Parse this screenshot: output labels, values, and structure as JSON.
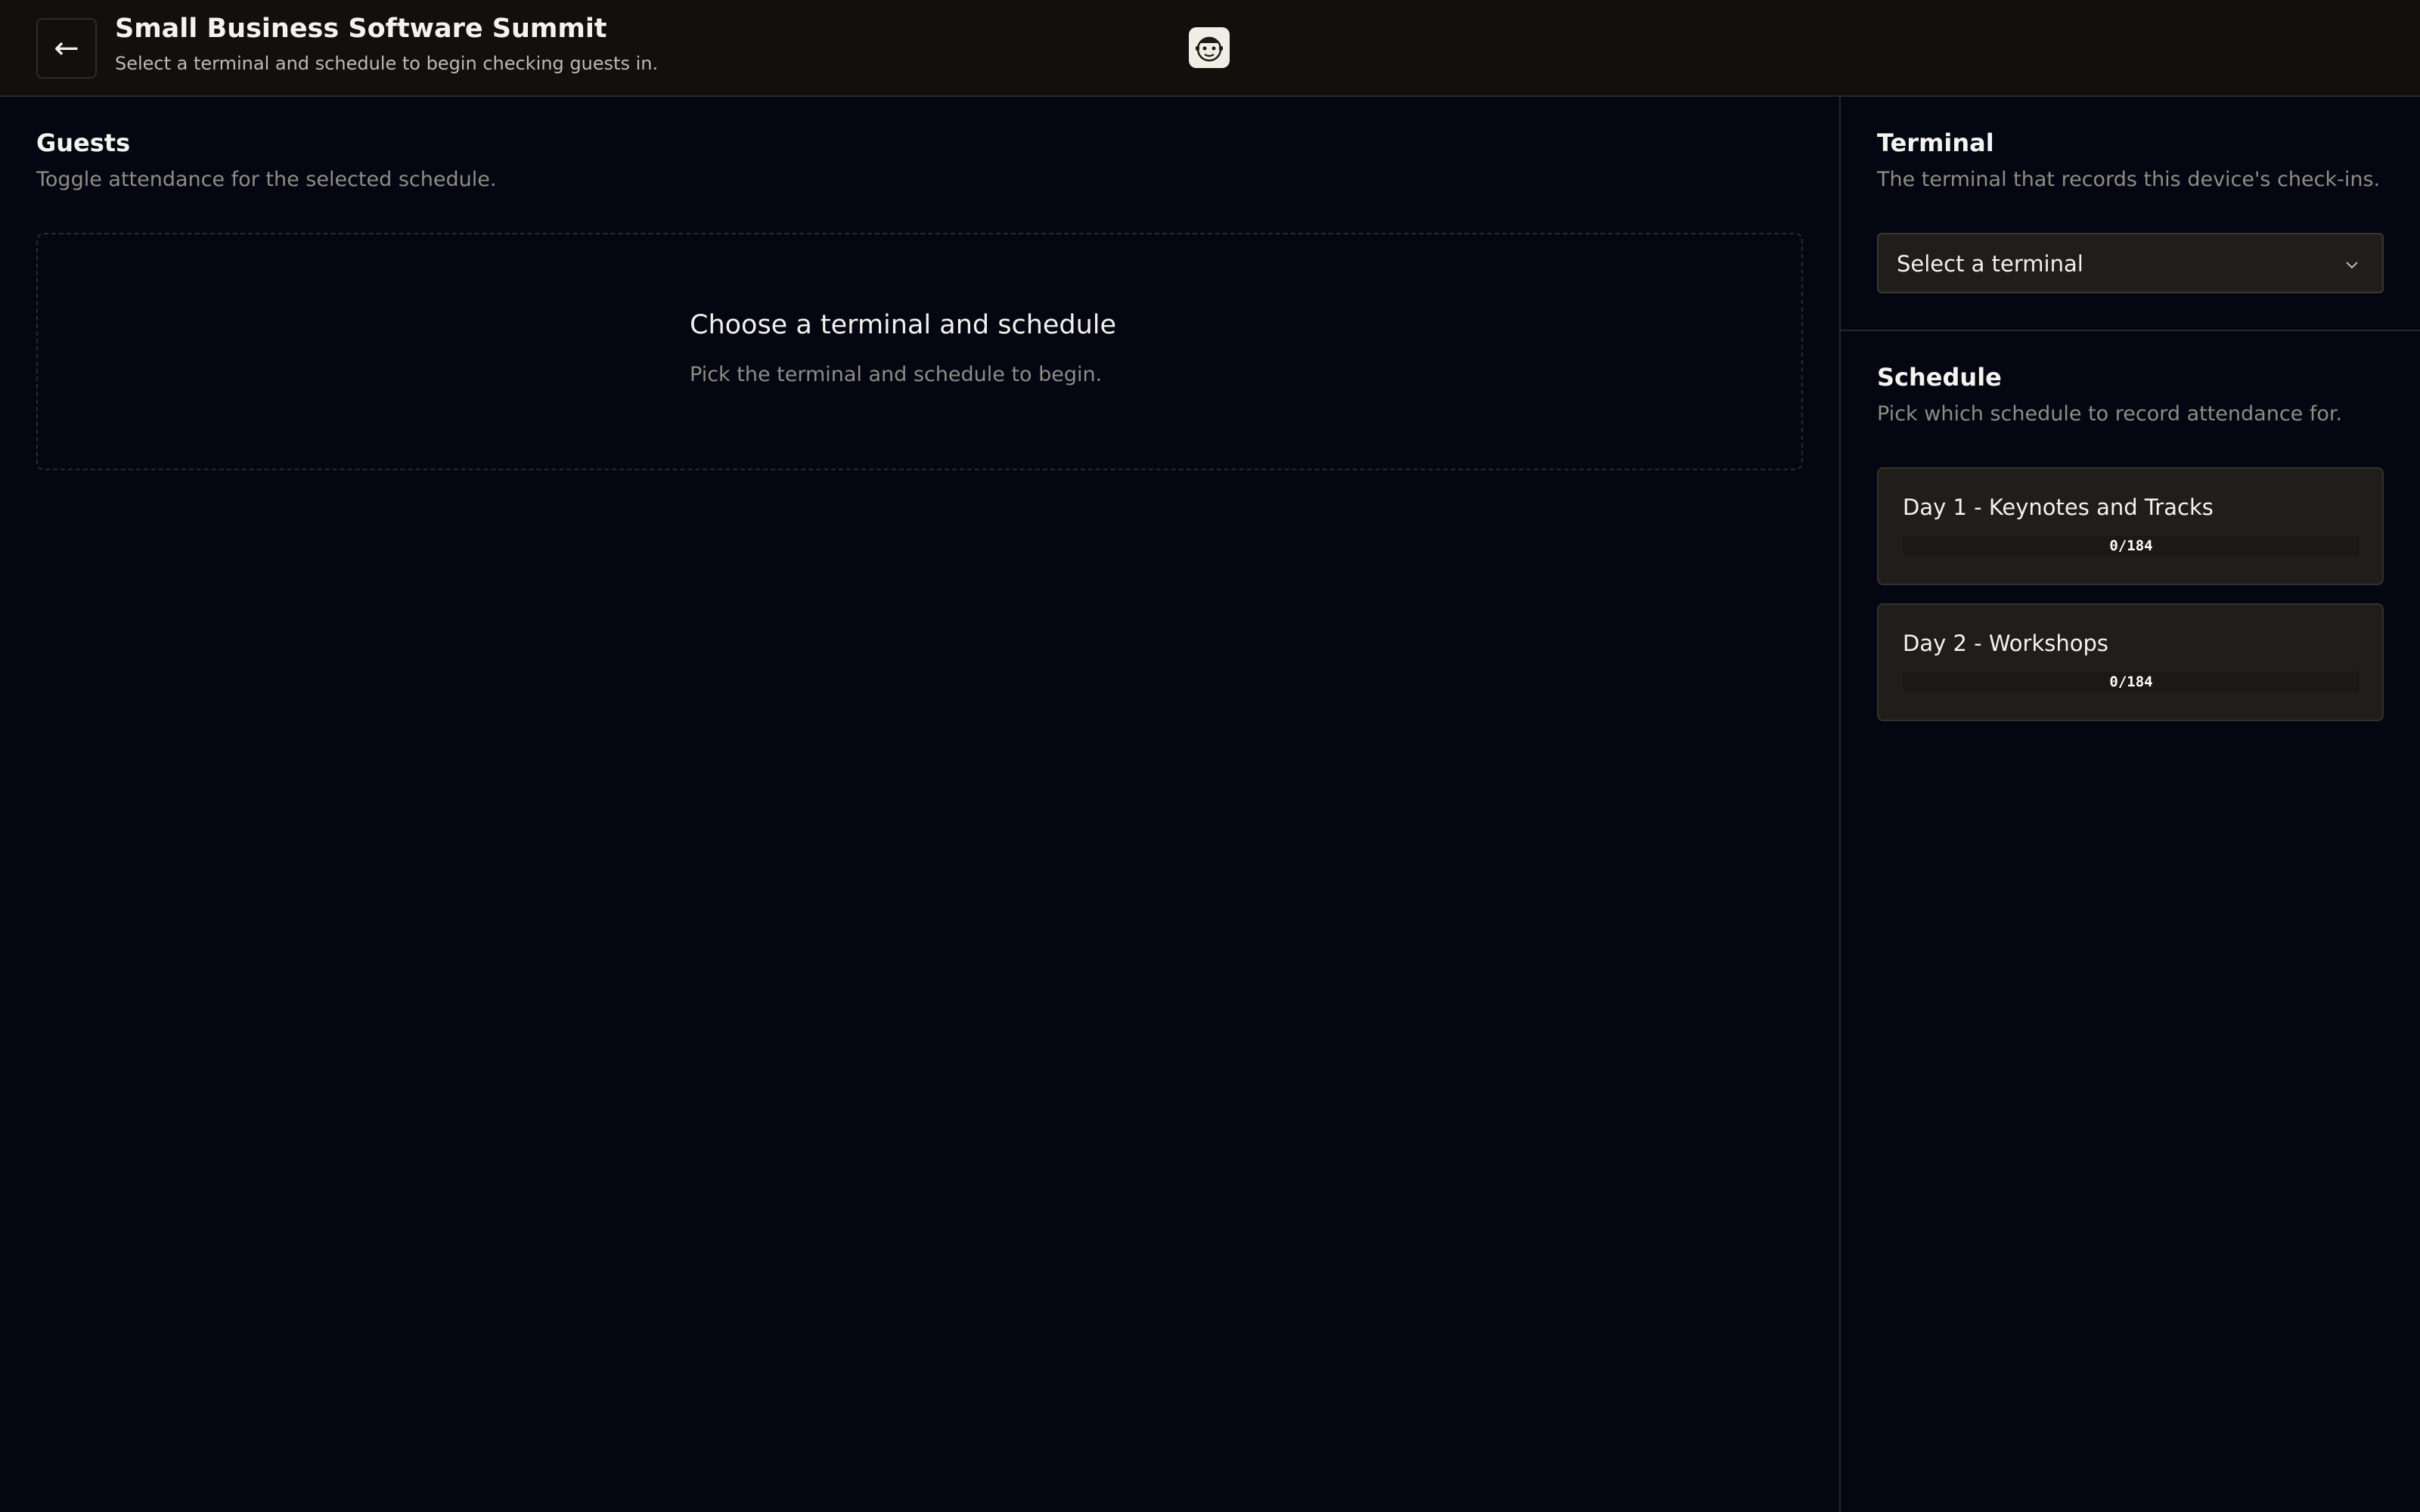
{
  "header": {
    "back_icon": "arrow-left-icon",
    "back_glyph": "←",
    "title": "Small Business Software Summit",
    "subtitle": "Select a terminal and schedule to begin checking guests in.",
    "logo_icon": "mascot-logo-icon"
  },
  "guests": {
    "title": "Guests",
    "description": "Toggle attendance for the selected schedule.",
    "empty_title": "Choose a terminal and schedule",
    "empty_description": "Pick the terminal and schedule to begin."
  },
  "terminal": {
    "title": "Terminal",
    "description": "The terminal that records this device's check-ins.",
    "select_value": "Select a terminal",
    "select_icon": "chevron-down-icon"
  },
  "schedule": {
    "title": "Schedule",
    "description": "Pick which schedule to record attendance for.",
    "items": [
      {
        "label": "Day 1 - Keynotes and Tracks",
        "checked_in": 0,
        "total": 184,
        "progress_text": "0/184"
      },
      {
        "label": "Day 2 - Workshops",
        "checked_in": 0,
        "total": 184,
        "progress_text": "0/184"
      }
    ]
  },
  "colors": {
    "background": "#040711",
    "topbar": "#11100d",
    "card": "#201e1a",
    "muted_text": "#8f8c86"
  }
}
